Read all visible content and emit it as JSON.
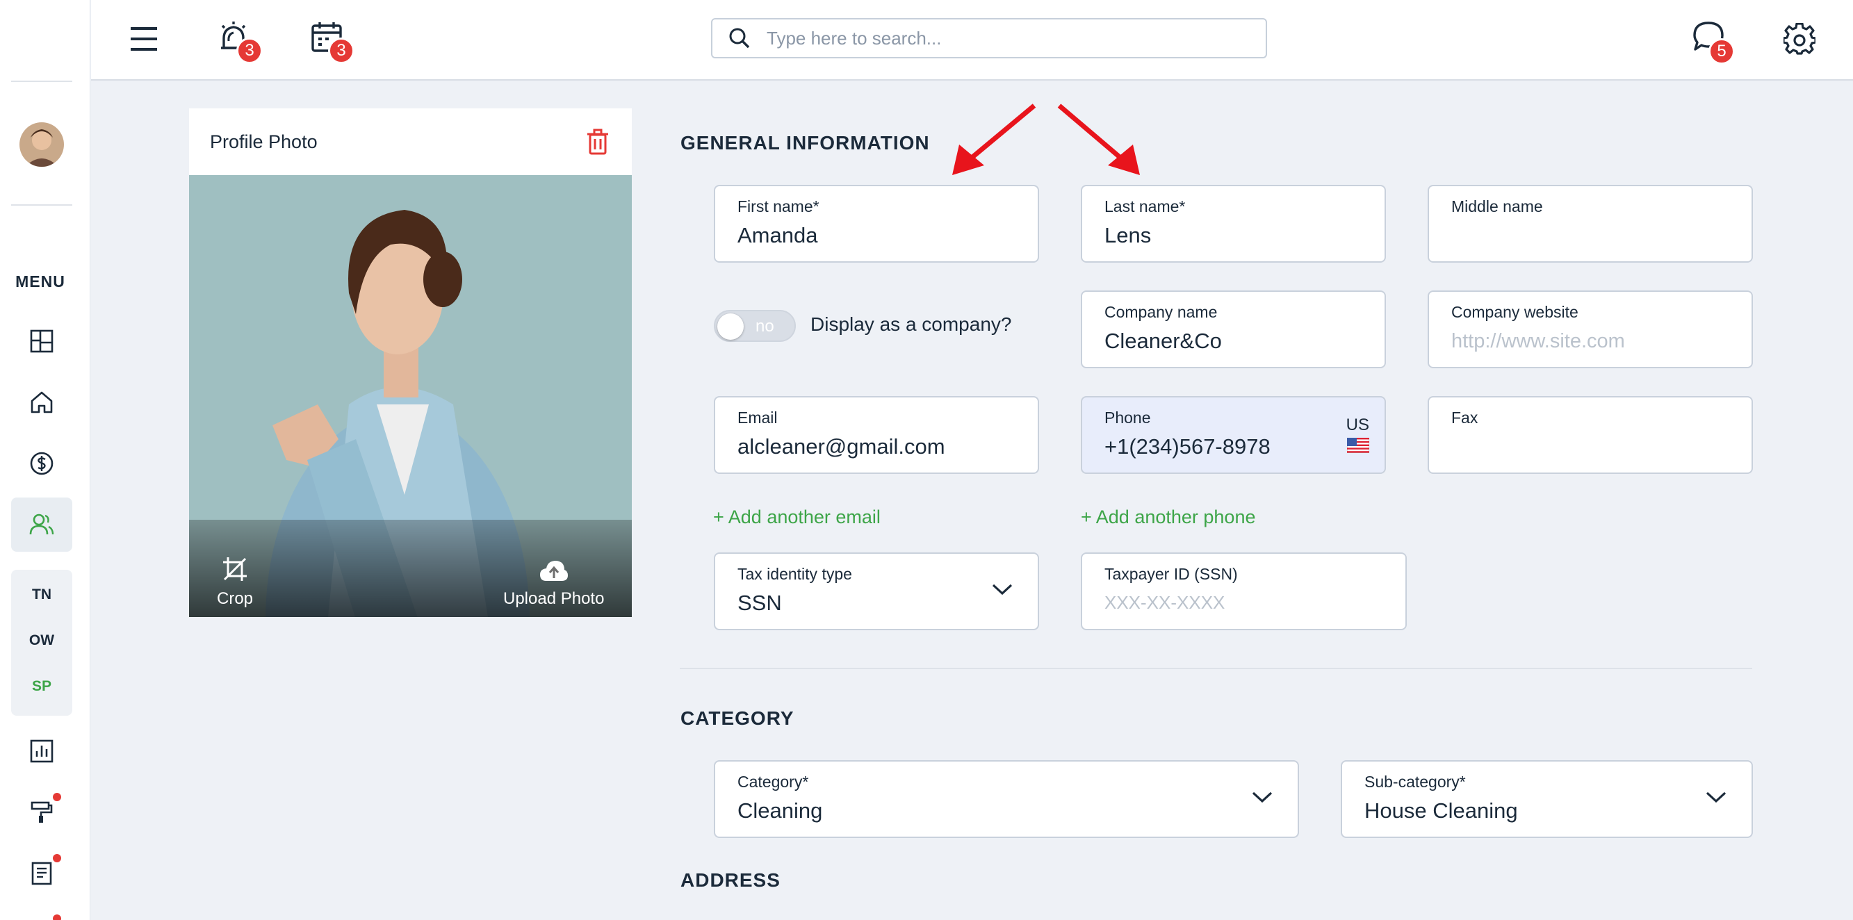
{
  "sidebar": {
    "menu_label": "MENU",
    "sub_items": [
      "TN",
      "OW",
      "SP"
    ]
  },
  "topbar": {
    "alarm_badge": "3",
    "calendar_badge": "3",
    "chat_badge": "5",
    "search_placeholder": "Type here to search..."
  },
  "profile_photo": {
    "title": "Profile Photo",
    "crop_label": "Crop",
    "upload_label": "Upload Photo"
  },
  "general": {
    "section_title": "GENERAL INFORMATION",
    "first_name": {
      "label": "First name*",
      "value": "Amanda"
    },
    "last_name": {
      "label": "Last name*",
      "value": "Lens"
    },
    "middle_name": {
      "label": "Middle name",
      "value": ""
    },
    "company_toggle": {
      "state": "no",
      "label": "Display as a company?"
    },
    "company_name": {
      "label": "Company name",
      "value": "Cleaner&Co"
    },
    "company_website": {
      "label": "Company website",
      "placeholder": "http://www.site.com"
    },
    "email": {
      "label": "Email",
      "value": "alcleaner@gmail.com"
    },
    "phone": {
      "label": "Phone",
      "value": "+1(234)567-8978",
      "country": "US"
    },
    "fax": {
      "label": "Fax",
      "value": ""
    },
    "add_email": "+ Add another email",
    "add_phone": "+ Add another phone",
    "tax_type": {
      "label": "Tax identity type",
      "value": "SSN"
    },
    "taxpayer_id": {
      "label": "Taxpayer ID (SSN)",
      "placeholder": "XXX-XX-XXXX"
    }
  },
  "category": {
    "section_title": "CATEGORY",
    "category": {
      "label": "Category*",
      "value": "Cleaning"
    },
    "sub_category": {
      "label": "Sub-category*",
      "value": "House Cleaning"
    }
  },
  "address": {
    "section_title": "ADDRESS"
  },
  "colors": {
    "accent_green": "#3da548",
    "badge_red": "#e53935",
    "arrow_red": "#e8141c",
    "text_dark": "#1b2a3a"
  }
}
